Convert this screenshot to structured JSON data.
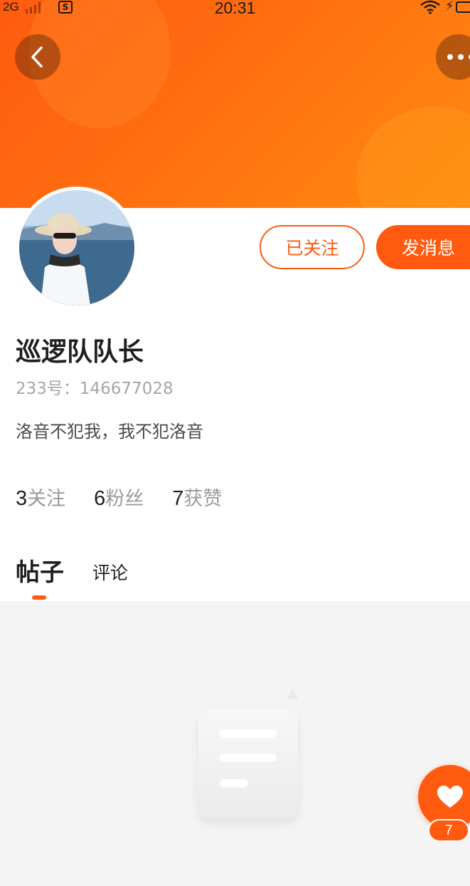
{
  "status_bar": {
    "network": "2G",
    "time": "20:31"
  },
  "profile": {
    "username": "巡逻队队长",
    "user_id": "233号：146677028",
    "bio": "洛音不犯我，我不犯洛音"
  },
  "actions": {
    "follow_label": "已关注",
    "message_label": "发消息"
  },
  "stats": [
    {
      "count": "3",
      "label": "关注"
    },
    {
      "count": "6",
      "label": "粉丝"
    },
    {
      "count": "7",
      "label": "获赞"
    }
  ],
  "tabs": {
    "active": "帖子",
    "items": [
      "帖子",
      "评论"
    ]
  },
  "like_button": {
    "count": "7"
  },
  "icons": {
    "back": "chevron-left-icon",
    "more": "more-horizontal-icon",
    "like": "heart-icon",
    "empty": "document-icon"
  },
  "colors": {
    "accent": "#ff5a0f"
  }
}
